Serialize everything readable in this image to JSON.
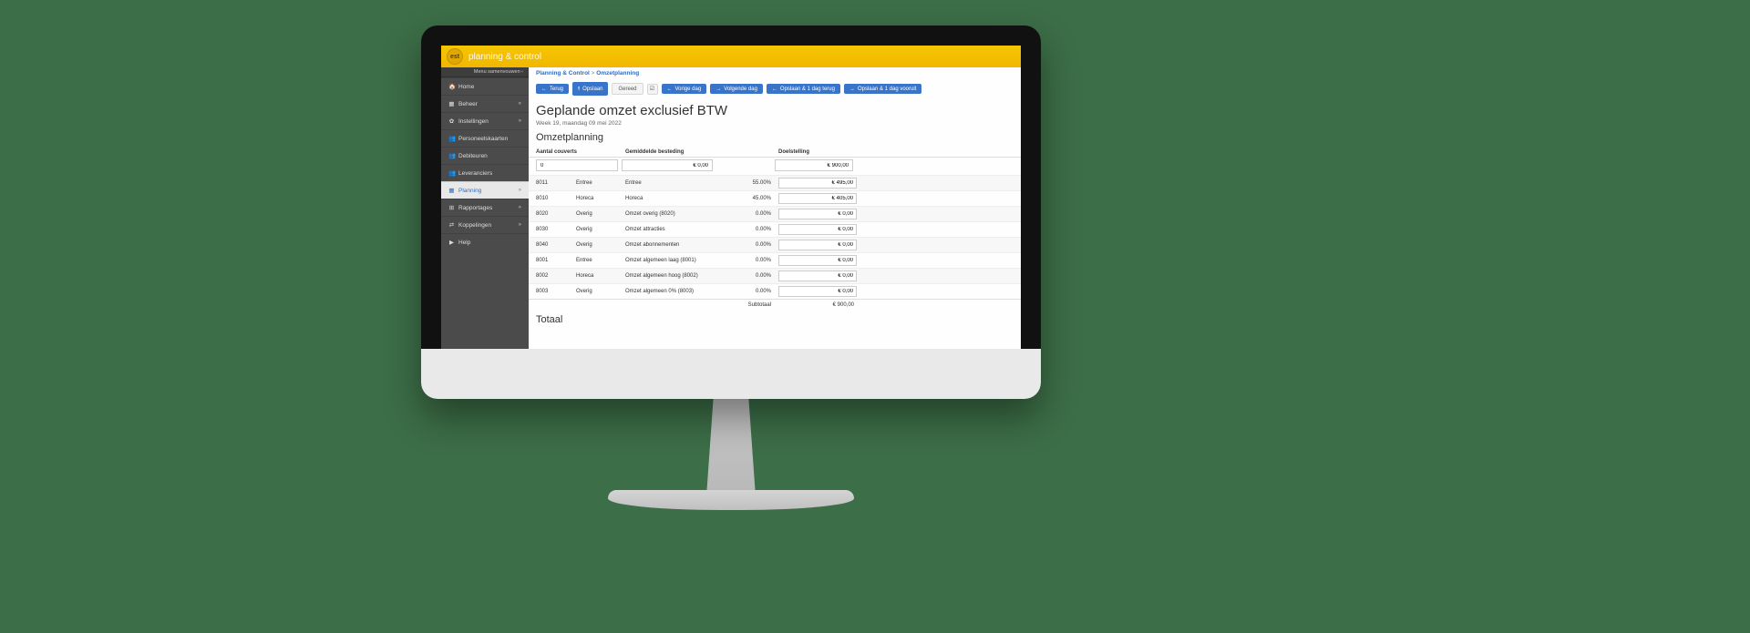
{
  "header": {
    "logo_text": "est",
    "app_title": "planning & control"
  },
  "sidebar": {
    "top_label": "Menu samenvouwen ‹",
    "items": [
      {
        "icon": "🏠",
        "label": "Home",
        "caret": ""
      },
      {
        "icon": "▦",
        "label": "Beheer",
        "caret": "»"
      },
      {
        "icon": "✿",
        "label": "Instellingen",
        "caret": "»"
      },
      {
        "icon": "👥",
        "label": "Personeelskaarten",
        "caret": ""
      },
      {
        "icon": "👥",
        "label": "Debiteuren",
        "caret": ""
      },
      {
        "icon": "👥",
        "label": "Leveranciers",
        "caret": ""
      },
      {
        "icon": "▦",
        "label": "Planning",
        "caret": "»"
      },
      {
        "icon": "⊞",
        "label": "Rapportages",
        "caret": "»"
      },
      {
        "icon": "⇄",
        "label": "Koppelingen",
        "caret": "»"
      },
      {
        "icon": "▶",
        "label": "Help",
        "caret": ""
      }
    ],
    "active_index": 6
  },
  "breadcrumb": {
    "root": "Planning & Control",
    "sep": ">",
    "leaf": "Omzetplanning"
  },
  "toolbar": {
    "back": "Terug",
    "save": "Opslaan",
    "done": "Gereed",
    "prev_day": "Vorige dag",
    "next_day": "Volgende dag",
    "save_back_day": "Opslaan & 1 dag terug",
    "save_fwd_day": "Opslaan & 1 dag vooruit"
  },
  "page": {
    "title": "Geplande omzet exclusief BTW",
    "date_line": "Week 19, maandag 09 mei 2022",
    "section": "Omzetplanning",
    "col_couverts": "Aantal couverts",
    "col_besteding": "Gemiddelde besteding",
    "col_doel": "Doelstelling",
    "inputs": {
      "couverts": "0",
      "besteding": "€ 0,00",
      "doel": "€ 900,00"
    },
    "rows": [
      {
        "code": "8011",
        "cat": "Entree",
        "desc": "Entree",
        "pct": "55.00%",
        "val": "€ 495,00"
      },
      {
        "code": "8010",
        "cat": "Horeca",
        "desc": "Horeca",
        "pct": "45.00%",
        "val": "€ 405,00"
      },
      {
        "code": "8020",
        "cat": "Overig",
        "desc": "Omzet overig (8020)",
        "pct": "0.00%",
        "val": "€ 0,00"
      },
      {
        "code": "8030",
        "cat": "Overig",
        "desc": "Omzet attracties",
        "pct": "0.00%",
        "val": "€ 0,00"
      },
      {
        "code": "8040",
        "cat": "Overig",
        "desc": "Omzet abonnementen",
        "pct": "0.00%",
        "val": "€ 0,00"
      },
      {
        "code": "8001",
        "cat": "Entree",
        "desc": "Omzet algemeen laag (8001)",
        "pct": "0.00%",
        "val": "€ 0,00"
      },
      {
        "code": "8002",
        "cat": "Horeca",
        "desc": "Omzet algemeen hoog (8002)",
        "pct": "0.00%",
        "val": "€ 0,00"
      },
      {
        "code": "8003",
        "cat": "Overig",
        "desc": "Omzet algemeen 0% (8003)",
        "pct": "0.00%",
        "val": "€ 0,00"
      }
    ],
    "subtotal_label": "Subtotaal",
    "subtotal_value": "€ 900,00",
    "total_label": "Totaal"
  }
}
